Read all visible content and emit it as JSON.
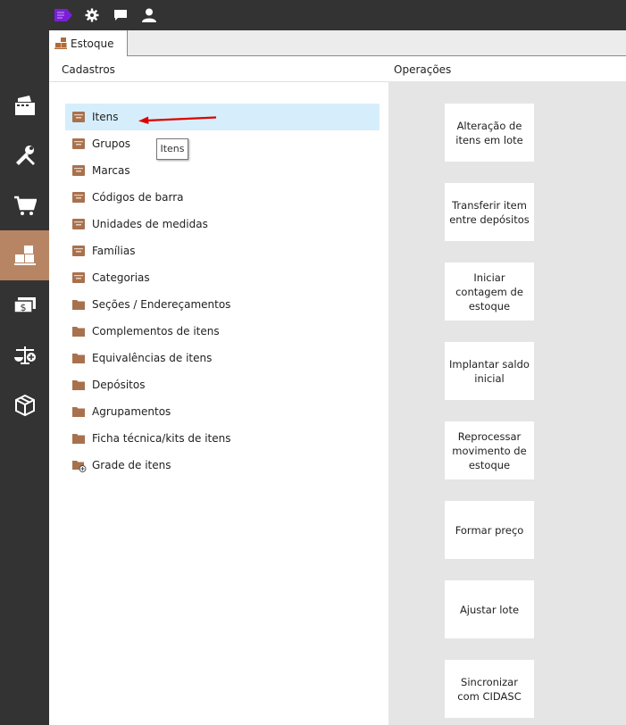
{
  "top_icons": [
    "tag-icon",
    "gear-icon",
    "chat-icon",
    "user-icon"
  ],
  "sidebar_icons": [
    "cash-register-icon",
    "tools-icon",
    "cart-icon",
    "boxes-icon",
    "money-icon",
    "scale-icon",
    "package-icon"
  ],
  "tab": {
    "label": "Estoque",
    "icon": "boxes-icon"
  },
  "sections": {
    "cadastros": "Cadastros",
    "operacoes": "Operações"
  },
  "cadastros": [
    {
      "label": "Itens",
      "icon": "drawer-icon",
      "selected": true
    },
    {
      "label": "Grupos",
      "icon": "drawer-icon"
    },
    {
      "label": "Marcas",
      "icon": "drawer-icon"
    },
    {
      "label": "Códigos de barra",
      "icon": "drawer-icon"
    },
    {
      "label": "Unidades de medidas",
      "icon": "drawer-icon"
    },
    {
      "label": "Famílias",
      "icon": "drawer-icon"
    },
    {
      "label": "Categorias",
      "icon": "drawer-icon"
    },
    {
      "label": "Seções / Endereçamentos",
      "icon": "folder-icon"
    },
    {
      "label": "Complementos de itens",
      "icon": "folder-icon"
    },
    {
      "label": "Equivalências de itens",
      "icon": "folder-icon"
    },
    {
      "label": "Depósitos",
      "icon": "folder-icon"
    },
    {
      "label": "Agrupamentos",
      "icon": "folder-icon"
    },
    {
      "label": "Ficha técnica/kits de itens",
      "icon": "folder-icon"
    },
    {
      "label": "Grade de itens",
      "icon": "folder-add-icon"
    }
  ],
  "tooltip": "Itens",
  "operacoes": [
    {
      "label": "Alteração de itens em lote"
    },
    {
      "label": "Transferir item entre depósitos"
    },
    {
      "label": "Iniciar contagem de estoque"
    },
    {
      "label": "Implantar saldo inicial"
    },
    {
      "label": "Reprocessar movimento de estoque"
    },
    {
      "label": "Formar preço"
    },
    {
      "label": "Ajustar lote"
    },
    {
      "label": "Sincronizar com CIDASC"
    }
  ],
  "colors": {
    "dark": "#333333",
    "accent": "#b88564",
    "selected": "#d6eefb",
    "brand": "#7a1fd6",
    "arrow": "#e00000",
    "pane": "#e5e5e5"
  }
}
